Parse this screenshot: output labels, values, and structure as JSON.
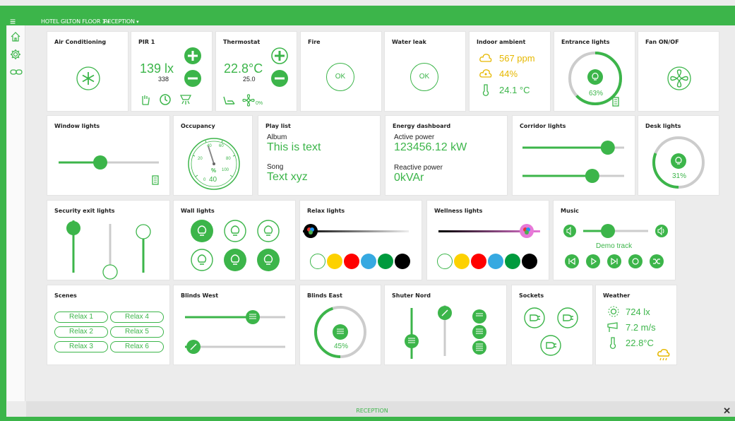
{
  "header": {
    "location_label": "HOTEL GILTON FLOOR 1",
    "room_label": "RECEPTION"
  },
  "status": {
    "label": "RECEPTION"
  },
  "colors": {
    "accent": "#3cb54a",
    "warning": "#e6b800",
    "track": "#cccccc"
  },
  "tiles": {
    "air_conditioning": {
      "title": "Air Conditioning",
      "icon": "snowflake-icon"
    },
    "pir1": {
      "title": "PIR 1",
      "value": "139 lx",
      "sub": "338"
    },
    "thermostat": {
      "title": "Thermostat",
      "value": "22.8°C",
      "setpoint": "25.0",
      "fan_pct": "0%"
    },
    "fire": {
      "title": "Fire",
      "state": "OK"
    },
    "water_leak": {
      "title": "Water leak",
      "state": "OK"
    },
    "indoor_ambient": {
      "title": "Indoor ambient",
      "co2": "567 ppm",
      "humidity": "44%",
      "temp": "24.1 °C"
    },
    "entrance_lights": {
      "title": "Entrance lights",
      "level": "63%",
      "level_value": 0.63
    },
    "fan": {
      "title": "Fan ON/OF"
    },
    "window_lights": {
      "title": "Window lights",
      "level_value": 0.4
    },
    "occupancy": {
      "title": "Occupancy",
      "value": "40",
      "unit": "%",
      "ticks": [
        "0",
        "20",
        "40",
        "60",
        "80",
        "100"
      ]
    },
    "playlist": {
      "title": "Play list",
      "album_label": "Album",
      "album": "This is text",
      "song_label": "Song",
      "song": "Text xyz"
    },
    "energy": {
      "title": "Energy dashboard",
      "active_label": "Active power",
      "active": "123456.12 kW",
      "reactive_label": "Reactive power",
      "reactive": "0kVAr"
    },
    "corridor_lights": {
      "title": "Corridor lights",
      "levels": [
        0.9,
        0.72
      ]
    },
    "desk_lights": {
      "title": "Desk lights",
      "level": "31%",
      "level_value": 0.31
    },
    "security_exit": {
      "title": "Security exit lights"
    },
    "wall_lights": {
      "title": "Wall lights"
    },
    "relax_lights": {
      "title": "Relax lights"
    },
    "wellness_lights": {
      "title": "Wellness lights"
    },
    "music": {
      "title": "Music",
      "track": "Demo track"
    },
    "scenes": {
      "title": "Scenes",
      "buttons": [
        "Relax 1",
        "Relax 4",
        "Relax 2",
        "Relax 5",
        "Relax 3",
        "Relax 6"
      ]
    },
    "blinds_west": {
      "title": "Blinds West"
    },
    "blinds_east": {
      "title": "Blinds East",
      "level": "45%",
      "level_value": 0.45
    },
    "shutter_nord": {
      "title": "Shuter Nord"
    },
    "sockets": {
      "title": "Sockets"
    },
    "weather": {
      "title": "Weather",
      "lux": "724 lx",
      "wind": "7.2 m/s",
      "temp": "22.8°C"
    }
  }
}
